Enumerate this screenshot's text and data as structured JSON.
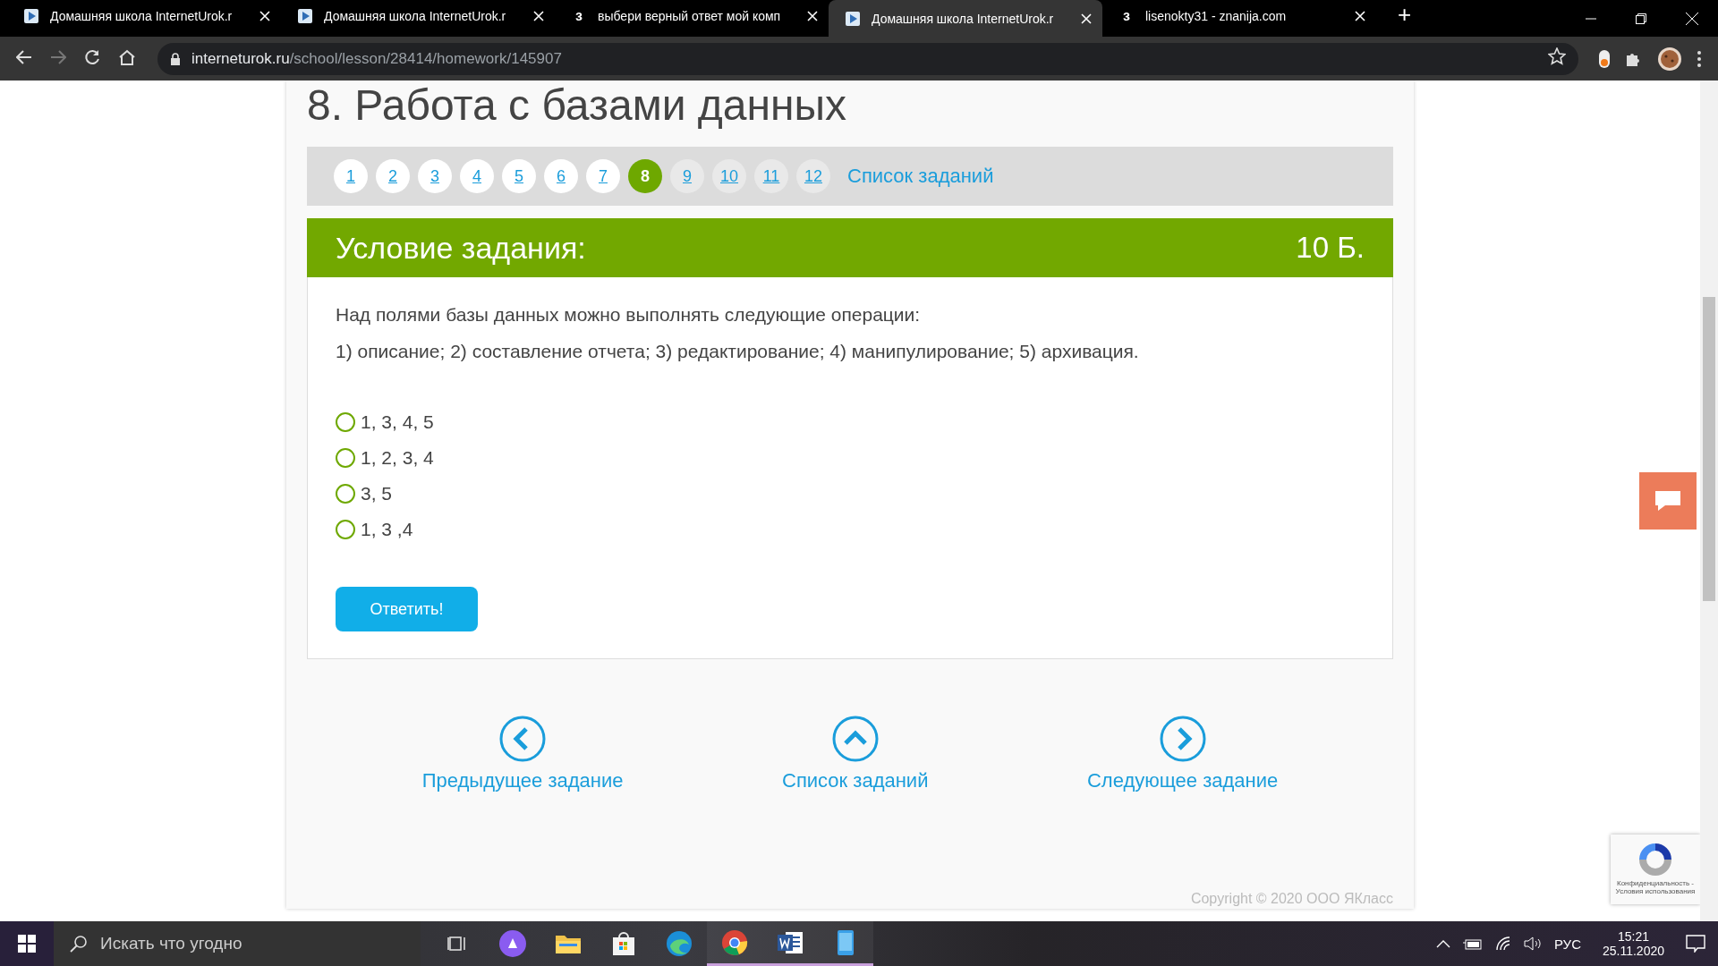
{
  "browser": {
    "tabs": [
      {
        "title": "Домашняя школа InternetUrok.r",
        "kind": "interneturok",
        "selected": false
      },
      {
        "title": "Домашняя школа InternetUrok.r",
        "kind": "interneturok",
        "selected": false
      },
      {
        "title": "выбери верный ответ мой комп",
        "kind": "znanija",
        "favicon": "з",
        "selected": false
      },
      {
        "title": "Домашняя школа InternetUrok.r",
        "kind": "interneturok",
        "selected": true
      },
      {
        "title": "lisenokty31 - znanija.com",
        "kind": "znanija",
        "favicon": "з",
        "selected": false
      }
    ],
    "new_tab": "+",
    "url_host": "interneturok.ru",
    "url_path": "/school/lesson/28414/homework/145907"
  },
  "page": {
    "title": "8. Работа с базами данных",
    "tasks": [
      {
        "label": "1",
        "selected": false,
        "answered": true
      },
      {
        "label": "2",
        "selected": false,
        "answered": true
      },
      {
        "label": "3",
        "selected": false,
        "answered": true
      },
      {
        "label": "4",
        "selected": false,
        "answered": true
      },
      {
        "label": "5",
        "selected": false,
        "answered": true
      },
      {
        "label": "6",
        "selected": false,
        "answered": true
      },
      {
        "label": "7",
        "selected": false,
        "answered": true
      },
      {
        "label": "8",
        "selected": true,
        "answered": false
      },
      {
        "label": "9",
        "selected": false,
        "answered": false
      },
      {
        "label": "10",
        "selected": false,
        "answered": false
      },
      {
        "label": "11",
        "selected": false,
        "answered": false
      },
      {
        "label": "12",
        "selected": false,
        "answered": false
      }
    ],
    "task_list_link": "Список заданий",
    "condition_title": "Условие задания:",
    "points": "10 Б.",
    "question": [
      "Над полями базы данных можно выполнять следующие операции:",
      "1) описание; 2) составление отчета; 3) редактирование; 4) манипулирование; 5) архивация."
    ],
    "options": [
      {
        "label": "1, 3, 4, 5",
        "selected": false
      },
      {
        "label": "1, 2, 3, 4",
        "selected": false
      },
      {
        "label": "3, 5",
        "selected": false
      },
      {
        "label": "1, 3 ,4",
        "selected": false
      }
    ],
    "submit": "Ответить!",
    "nav": [
      {
        "kind": "prev",
        "label": "Предыдущее задание"
      },
      {
        "kind": "up",
        "label": "Список заданий"
      },
      {
        "kind": "next",
        "label": "Следующее задание"
      }
    ],
    "copyright": "Copyright © 2020 ООО ЯКласс",
    "recaptcha": [
      "Конфиденциальность -",
      "Условия использования"
    ]
  },
  "taskbar": {
    "search_placeholder": "Искать что угодно",
    "apps": [
      {
        "kind": "taskview",
        "running": false
      },
      {
        "kind": "alice",
        "running": false
      },
      {
        "kind": "explorer",
        "running": false
      },
      {
        "kind": "store",
        "running": false
      },
      {
        "kind": "edge",
        "running": false
      },
      {
        "kind": "chrome",
        "running": true
      },
      {
        "kind": "word",
        "running": true
      },
      {
        "kind": "phone",
        "running": true
      }
    ],
    "language": "РУС",
    "time": "15:21",
    "date": "25.11.2020"
  }
}
